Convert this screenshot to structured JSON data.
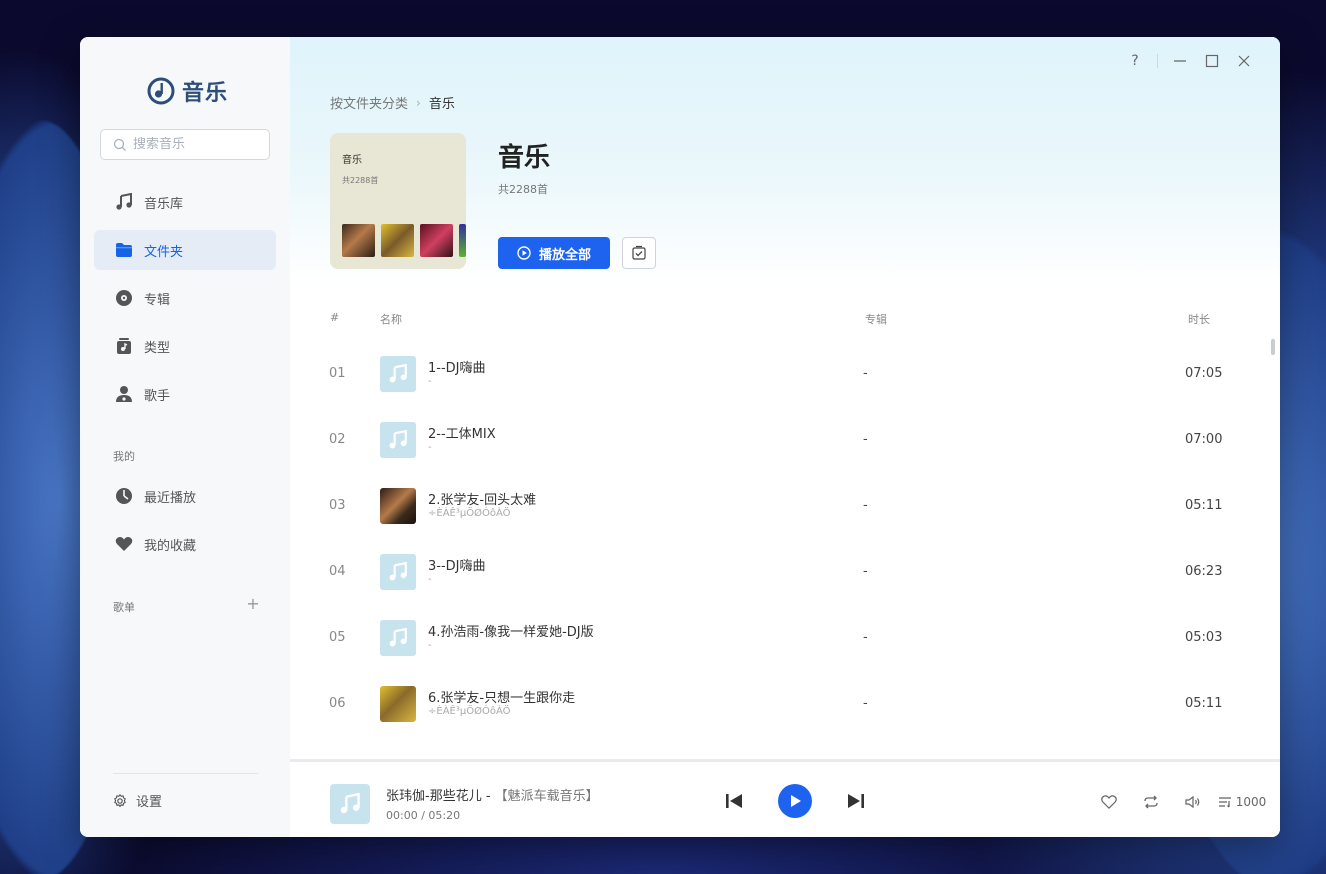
{
  "app": {
    "name": "音乐",
    "accent_color": "#1e63f0"
  },
  "window_controls": {
    "help_label": "?",
    "icons": [
      "help-icon",
      "minimize-icon",
      "maximize-icon",
      "close-icon"
    ]
  },
  "sidebar": {
    "search_placeholder": "搜索音乐",
    "nav": [
      {
        "label": "音乐库",
        "icon": "music-note-icon",
        "active": false
      },
      {
        "label": "文件夹",
        "icon": "folder-icon",
        "active": true
      },
      {
        "label": "专辑",
        "icon": "disc-icon",
        "active": false
      },
      {
        "label": "类型",
        "icon": "genre-icon",
        "active": false
      },
      {
        "label": "歌手",
        "icon": "singer-icon",
        "active": false
      }
    ],
    "mine_label": "我的",
    "mine": [
      {
        "label": "最近播放",
        "icon": "clock-icon"
      },
      {
        "label": "我的收藏",
        "icon": "heart-icon"
      }
    ],
    "playlists_label": "歌单",
    "add_label": "+",
    "settings_label": "设置"
  },
  "breadcrumb": {
    "parent": "按文件夹分类",
    "current": "音乐"
  },
  "header": {
    "cover_title": "音乐",
    "cover_count": "共2288首",
    "title": "音乐",
    "count": "共2288首",
    "play_all_label": "播放全部"
  },
  "table": {
    "columns": {
      "index": "#",
      "name": "名称",
      "album": "专辑",
      "duration": "时长"
    },
    "rows": [
      {
        "index": "01",
        "title": "1--DJ嗨曲",
        "artist": "-",
        "album": "-",
        "duration": "07:05",
        "art": "placeholder"
      },
      {
        "index": "02",
        "title": "2--工体MIX",
        "artist": "-",
        "album": "-",
        "duration": "07:00",
        "art": "placeholder"
      },
      {
        "index": "03",
        "title": "2.张学友-回头太难",
        "artist": "÷ÈÀÊ³µÖØÓôÀÖ",
        "album": "-",
        "duration": "05:11",
        "art": "photo-dark"
      },
      {
        "index": "04",
        "title": "3--DJ嗨曲",
        "artist": "-",
        "album": "-",
        "duration": "06:23",
        "art": "placeholder"
      },
      {
        "index": "05",
        "title": "4.孙浩雨-像我一样爱她-DJ版",
        "artist": "-",
        "album": "-",
        "duration": "05:03",
        "art": "placeholder"
      },
      {
        "index": "06",
        "title": "6.张学友-只想一生跟你走",
        "artist": "÷ÈÀÊ³µÖØÓôÀÖ",
        "album": "-",
        "duration": "05:11",
        "art": "photo-yellow"
      }
    ]
  },
  "player": {
    "title": "张玮伽-那些花儿 - ",
    "album": "【魅派车载音乐】",
    "time": "00:00 / 05:20",
    "queue_count": "1000"
  }
}
